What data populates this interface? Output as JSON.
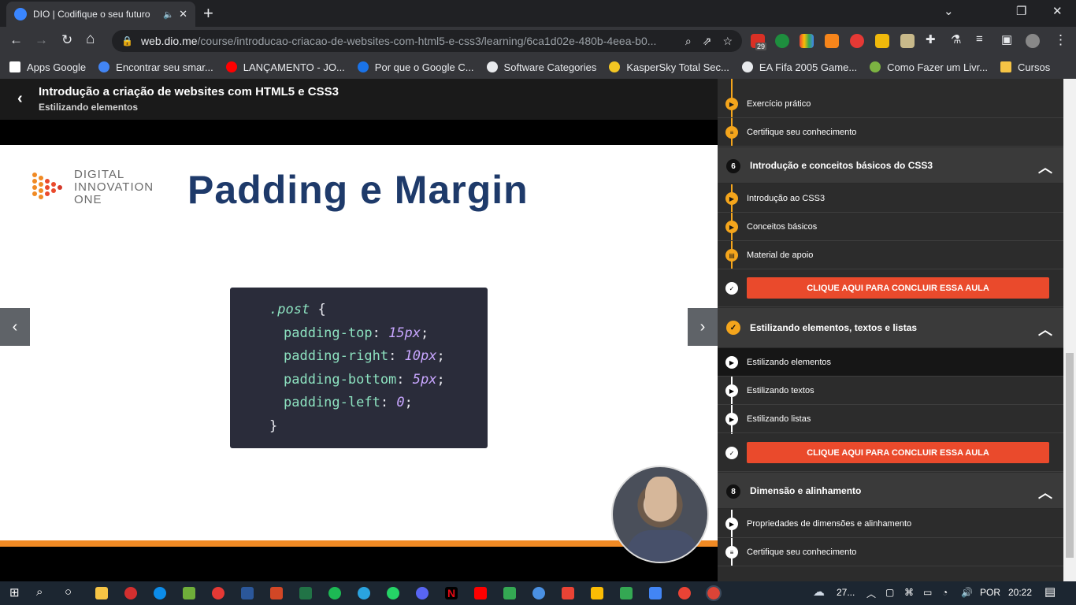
{
  "browser": {
    "tab": {
      "title": "DIO | Codifique o seu futuro",
      "close": "✕"
    },
    "new_tab": "+",
    "window": {
      "minimize": "⌄",
      "restore": "❐",
      "close": "✕"
    },
    "nav": {
      "back": "←",
      "forward": "→",
      "reload": "↻",
      "home": "⌂"
    },
    "url": {
      "host": "web.dio.me",
      "path": "/course/introducao-criacao-de-websites-com-html5-e-css3/learning/6ca1d02e-480b-4eea-b0..."
    },
    "bookmarks": [
      {
        "label": "Apps Google",
        "color": "#ffffff"
      },
      {
        "label": "Encontrar seu smar...",
        "color": "#4285f4"
      },
      {
        "label": "LANÇAMENTO - JO...",
        "color": "#ff0000"
      },
      {
        "label": "Por que o Google C...",
        "color": "#1a73e8"
      },
      {
        "label": "Software Categories",
        "color": "#e8eaed"
      },
      {
        "label": "KasperSky Total Sec...",
        "color": "#f3c623"
      },
      {
        "label": "EA Fifa 2005 Game...",
        "color": "#e8eaed"
      },
      {
        "label": "Como Fazer um Livr...",
        "color": "#7cb342"
      },
      {
        "label": "Cursos",
        "color": "#f6c445"
      }
    ],
    "extension_badge": "29"
  },
  "course": {
    "back_icon": "‹",
    "title": "Introdução a criação de websites com HTML5 e CSS3",
    "subtitle": "Estilizando elementos"
  },
  "slide": {
    "logo_lines": [
      "DIGITAL",
      "INNOVATION",
      "ONE"
    ],
    "title": "Padding e Margin",
    "code": {
      "selector": ".post",
      "open": "{",
      "close": "}",
      "lines": [
        {
          "prop": "padding-top",
          "value": "15px"
        },
        {
          "prop": "padding-right",
          "value": "10px"
        },
        {
          "prop": "padding-bottom",
          "value": "5px"
        },
        {
          "prop": "padding-left",
          "value": "0"
        }
      ]
    },
    "prev": "‹",
    "next": "›"
  },
  "sidebar": {
    "top_items": [
      {
        "label": "Exercício prático"
      },
      {
        "label": "Certifique seu conhecimento"
      }
    ],
    "section6": {
      "number": "6",
      "title": "Introdução e conceitos básicos do CSS3",
      "items": [
        {
          "label": "Introdução ao CSS3"
        },
        {
          "label": "Conceitos básicos"
        },
        {
          "label": "Material de apoio"
        }
      ],
      "button": "CLIQUE AQUI PARA CONCLUIR ESSA AULA"
    },
    "section7": {
      "title": "Estilizando elementos, textos e listas",
      "items": [
        {
          "label": "Estilizando elementos"
        },
        {
          "label": "Estilizando textos"
        },
        {
          "label": "Estilizando listas"
        }
      ],
      "button": "CLIQUE AQUI PARA CONCLUIR ESSA AULA"
    },
    "section8": {
      "number": "8",
      "title": "Dimensão e alinhamento",
      "items": [
        {
          "label": "Propriedades de dimensões e alinhamento"
        },
        {
          "label": "Certifique seu conhecimento"
        }
      ]
    },
    "chevron": "︿"
  },
  "taskbar": {
    "weather": "27...",
    "language": "POR",
    "time": "20:22"
  }
}
